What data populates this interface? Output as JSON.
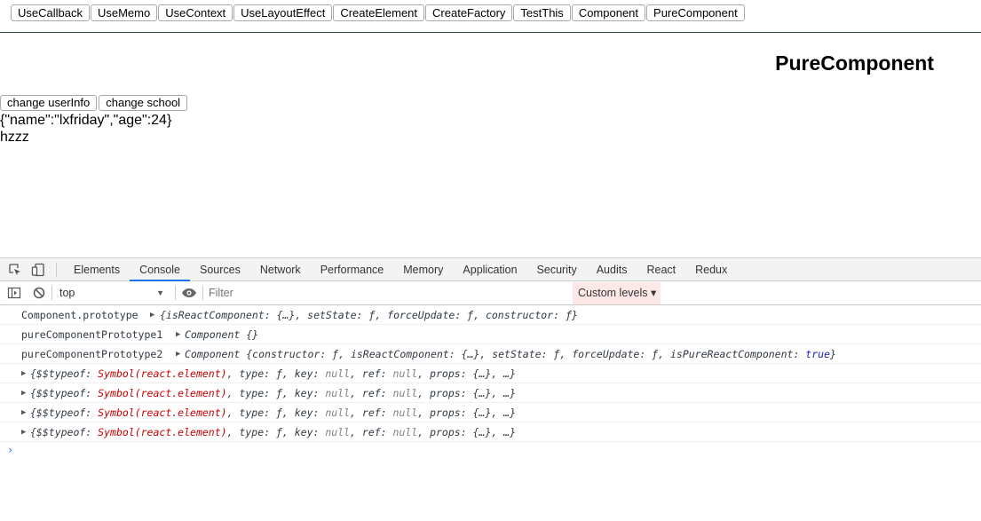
{
  "nav": [
    "UseCallback",
    "UseMemo",
    "UseContext",
    "UseLayoutEffect",
    "CreateElement",
    "CreateFactory",
    "TestThis",
    "Component",
    "PureComponent"
  ],
  "page": {
    "title": "PureComponent",
    "btn_user": "change userInfo",
    "btn_school": "change school",
    "user_json": "{\"name\":\"lxfriday\",\"age\":24}",
    "school": "hzzz"
  },
  "devtools": {
    "tabs": [
      "Elements",
      "Console",
      "Sources",
      "Network",
      "Performance",
      "Memory",
      "Application",
      "Security",
      "Audits",
      "React",
      "Redux"
    ],
    "active_tab": "Console",
    "context": "top",
    "filter_placeholder": "Filter",
    "levels": "Custom levels ▾",
    "logs": {
      "l1_label": "Component.prototype",
      "l1_body": "{isReactComponent: {…}, setState: ƒ, forceUpdate: ƒ, constructor: ƒ}",
      "l2_label": "pureComponentPrototype1",
      "l2_body": "Component {}",
      "l3_label": "pureComponentPrototype2",
      "l3_body_a": "Component",
      "l3_body_b": "{constructor: ƒ, isReactComponent: {…}, setState: ƒ, forceUpdate: ƒ, isPureReactComponent: ",
      "l3_true": "true",
      "l3_end": "}",
      "el_a": "{$$typeof: ",
      "el_sym": "Symbol(react.element)",
      "el_b": ", type: ƒ, key: ",
      "el_null": "null",
      "el_c": ", ref: ",
      "el_d": ", props: {…}, …}"
    }
  },
  "colors": {
    "accent": "#1a73e8",
    "levels_bg": "#fde7e7",
    "symbol": "#c80000"
  }
}
